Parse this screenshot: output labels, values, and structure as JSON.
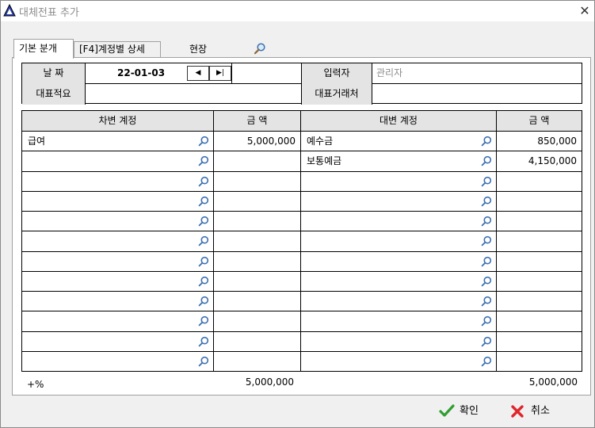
{
  "window": {
    "title": "대체전표 추가"
  },
  "tabs": [
    {
      "label": "기본 분개"
    },
    {
      "label": "[F4]계정별 상세"
    },
    {
      "label": "현장"
    }
  ],
  "header_form": {
    "date_label": "날   짜",
    "date_value": "22-01-03",
    "prev_label": "◀",
    "last_label": "▶|",
    "enterer_label": "입력자",
    "enterer_value": "관리자",
    "summary_label": "대표적요",
    "summary_value": "",
    "partner_label": "대표거래처",
    "partner_value": ""
  },
  "grid": {
    "columns": [
      "차변 계정",
      "금   액",
      "대변 계정",
      "금   액"
    ],
    "rows": [
      {
        "debit_account": "급여",
        "debit_amount": "5,000,000",
        "credit_account": "예수금",
        "credit_amount": "850,000"
      },
      {
        "debit_account": "",
        "debit_amount": "",
        "credit_account": "보통예금",
        "credit_amount": "4,150,000"
      },
      {
        "debit_account": "",
        "debit_amount": "",
        "credit_account": "",
        "credit_amount": ""
      },
      {
        "debit_account": "",
        "debit_amount": "",
        "credit_account": "",
        "credit_amount": ""
      },
      {
        "debit_account": "",
        "debit_amount": "",
        "credit_account": "",
        "credit_amount": ""
      },
      {
        "debit_account": "",
        "debit_amount": "",
        "credit_account": "",
        "credit_amount": ""
      },
      {
        "debit_account": "",
        "debit_amount": "",
        "credit_account": "",
        "credit_amount": ""
      },
      {
        "debit_account": "",
        "debit_amount": "",
        "credit_account": "",
        "credit_amount": ""
      },
      {
        "debit_account": "",
        "debit_amount": "",
        "credit_account": "",
        "credit_amount": ""
      },
      {
        "debit_account": "",
        "debit_amount": "",
        "credit_account": "",
        "credit_amount": ""
      },
      {
        "debit_account": "",
        "debit_amount": "",
        "credit_account": "",
        "credit_amount": ""
      },
      {
        "debit_account": "",
        "debit_amount": "",
        "credit_account": "",
        "credit_amount": ""
      }
    ]
  },
  "totals": {
    "percent_label": "+%",
    "debit_total": "5,000,000",
    "credit_total": "5,000,000"
  },
  "buttons": {
    "ok_label": "확인",
    "cancel_label": "취소"
  },
  "icons": {
    "app": "triangle-app-icon",
    "close": "close-icon",
    "search": "search-icon",
    "lookup": "lookup-icon",
    "ok": "checkmark-icon",
    "cancel": "x-icon"
  },
  "colors": {
    "header_gray": "#e4e4e4",
    "ok_green": "#2e9e2e",
    "cancel_red": "#e0262b",
    "app_icon_blue": "#2a3fb5"
  }
}
